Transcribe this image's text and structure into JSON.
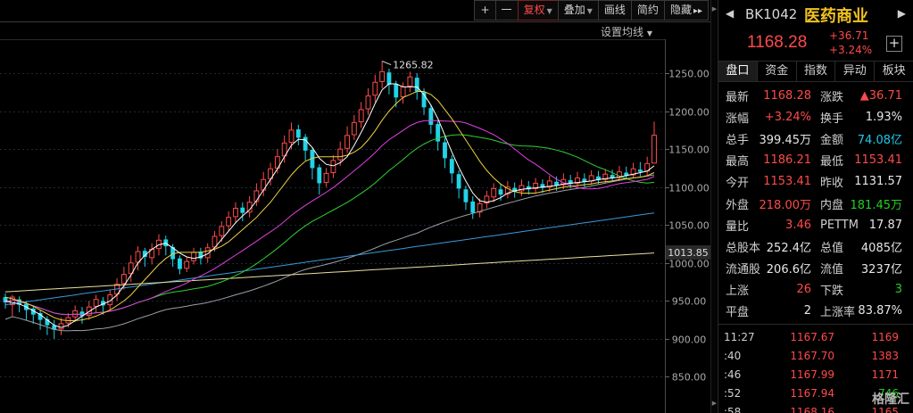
{
  "toolbar": {
    "plus": "+",
    "minus": "一",
    "fuquan": "复权",
    "diejia": "叠加",
    "huaxian": "画线",
    "jianyue": "简约",
    "yincang": "隐藏",
    "more": "▸▸"
  },
  "settings_ma_label": "设置均线",
  "colors": {
    "up": "#ff4a4a",
    "down": "#22d3e6",
    "ma5": "#ffffff",
    "ma10": "#f0d040",
    "ma20": "#e040e0",
    "ma30": "#30d030",
    "ma60": "#9aa0a6",
    "ma120": "#3a9ad9",
    "ma250": "#e8e0a0"
  },
  "chart_data": {
    "type": "candlestick",
    "y_ticks": [
      "1250.00",
      "1200.00",
      "1150.00",
      "1100.00",
      "1050.00",
      "1000.00",
      "950.00",
      "900.00",
      "850.00"
    ],
    "ylim": [
      820,
      1290
    ],
    "current_marker": "1013.85",
    "peak_label": "1265.82",
    "candles": [
      [
        955,
        948,
        940,
        960
      ],
      [
        945,
        955,
        930,
        958
      ],
      [
        952,
        945,
        935,
        956
      ],
      [
        946,
        938,
        925,
        950
      ],
      [
        940,
        932,
        920,
        944
      ],
      [
        934,
        925,
        912,
        938
      ],
      [
        926,
        918,
        905,
        930
      ],
      [
        918,
        912,
        900,
        925
      ],
      [
        913,
        920,
        905,
        928
      ],
      [
        921,
        928,
        915,
        934
      ],
      [
        929,
        937,
        922,
        944
      ],
      [
        936,
        930,
        920,
        942
      ],
      [
        931,
        942,
        925,
        950
      ],
      [
        943,
        952,
        935,
        958
      ],
      [
        950,
        944,
        932,
        955
      ],
      [
        945,
        958,
        938,
        965
      ],
      [
        959,
        972,
        950,
        980
      ],
      [
        973,
        985,
        965,
        995
      ],
      [
        986,
        1000,
        975,
        1010
      ],
      [
        1001,
        1015,
        990,
        1022
      ],
      [
        1016,
        1008,
        995,
        1020
      ],
      [
        1007,
        1018,
        998,
        1026
      ],
      [
        1019,
        1030,
        1010,
        1038
      ],
      [
        1031,
        1022,
        1010,
        1036
      ],
      [
        1021,
        1005,
        995,
        1025
      ],
      [
        1006,
        992,
        985,
        1010
      ],
      [
        993,
        1002,
        988,
        1008
      ],
      [
        1003,
        1014,
        998,
        1020
      ],
      [
        1015,
        1006,
        998,
        1020
      ],
      [
        1007,
        1020,
        1000,
        1026
      ],
      [
        1021,
        1035,
        1015,
        1042
      ],
      [
        1036,
        1048,
        1028,
        1055
      ],
      [
        1049,
        1060,
        1042,
        1068
      ],
      [
        1061,
        1072,
        1052,
        1080
      ],
      [
        1073,
        1066,
        1055,
        1080
      ],
      [
        1067,
        1080,
        1060,
        1088
      ],
      [
        1081,
        1095,
        1075,
        1105
      ],
      [
        1096,
        1110,
        1088,
        1120
      ],
      [
        1111,
        1124,
        1102,
        1132
      ],
      [
        1125,
        1140,
        1118,
        1150
      ],
      [
        1141,
        1158,
        1132,
        1168
      ],
      [
        1159,
        1175,
        1150,
        1185
      ],
      [
        1176,
        1165,
        1155,
        1182
      ],
      [
        1166,
        1148,
        1135,
        1170
      ],
      [
        1149,
        1125,
        1110,
        1152
      ],
      [
        1126,
        1105,
        1090,
        1130
      ],
      [
        1106,
        1118,
        1100,
        1125
      ],
      [
        1119,
        1135,
        1112,
        1142
      ],
      [
        1136,
        1150,
        1128,
        1160
      ],
      [
        1151,
        1168,
        1145,
        1180
      ],
      [
        1169,
        1185,
        1162,
        1195
      ],
      [
        1186,
        1202,
        1178,
        1212
      ],
      [
        1203,
        1220,
        1195,
        1230
      ],
      [
        1221,
        1238,
        1212,
        1248
      ],
      [
        1239,
        1252,
        1230,
        1265.82
      ],
      [
        1251,
        1235,
        1222,
        1256
      ],
      [
        1236,
        1218,
        1205,
        1240
      ],
      [
        1219,
        1232,
        1210,
        1238
      ],
      [
        1233,
        1245,
        1225,
        1252
      ],
      [
        1244,
        1226,
        1215,
        1250
      ],
      [
        1225,
        1205,
        1195,
        1230
      ],
      [
        1204,
        1182,
        1170,
        1208
      ],
      [
        1183,
        1160,
        1148,
        1188
      ],
      [
        1159,
        1138,
        1125,
        1165
      ],
      [
        1137,
        1118,
        1105,
        1142
      ],
      [
        1117,
        1098,
        1085,
        1122
      ],
      [
        1097,
        1080,
        1070,
        1102
      ],
      [
        1081,
        1066,
        1058,
        1088
      ],
      [
        1067,
        1078,
        1060,
        1085
      ],
      [
        1079,
        1088,
        1072,
        1095
      ],
      [
        1087,
        1098,
        1080,
        1105
      ],
      [
        1097,
        1090,
        1082,
        1104
      ],
      [
        1091,
        1100,
        1085,
        1108
      ],
      [
        1099,
        1094,
        1086,
        1106
      ],
      [
        1095,
        1102,
        1088,
        1110
      ],
      [
        1101,
        1097,
        1090,
        1108
      ],
      [
        1098,
        1105,
        1092,
        1112
      ],
      [
        1104,
        1099,
        1092,
        1110
      ],
      [
        1100,
        1108,
        1094,
        1115
      ],
      [
        1107,
        1102,
        1095,
        1114
      ],
      [
        1103,
        1110,
        1097,
        1118
      ],
      [
        1109,
        1104,
        1098,
        1116
      ],
      [
        1105,
        1112,
        1100,
        1120
      ],
      [
        1111,
        1107,
        1100,
        1118
      ],
      [
        1108,
        1115,
        1103,
        1122
      ],
      [
        1114,
        1109,
        1104,
        1121
      ],
      [
        1110,
        1117,
        1105,
        1124
      ],
      [
        1116,
        1112,
        1107,
        1123
      ],
      [
        1113,
        1120,
        1108,
        1128
      ],
      [
        1119,
        1115,
        1110,
        1127
      ],
      [
        1116,
        1124,
        1112,
        1132
      ],
      [
        1123,
        1120,
        1114,
        1133
      ],
      [
        1121,
        1131,
        1116,
        1140
      ],
      [
        1131.57,
        1168.28,
        1153.41,
        1186.21
      ]
    ],
    "ma_lines": {
      "ma5": [
        950,
        948,
        946,
        942,
        937,
        932,
        925,
        918,
        915,
        918,
        924,
        930,
        936,
        942,
        946,
        950,
        958,
        970,
        984,
        1000,
        1010,
        1018,
        1024,
        1026,
        1020,
        1013,
        1008,
        1006,
        1008,
        1012,
        1020,
        1031,
        1042,
        1053,
        1062,
        1070,
        1082,
        1096,
        1110,
        1124,
        1140,
        1155,
        1163,
        1162,
        1152,
        1138,
        1130,
        1128,
        1132,
        1140,
        1155,
        1172,
        1190,
        1210,
        1228,
        1236,
        1236,
        1232,
        1232,
        1232,
        1222,
        1208,
        1190,
        1168,
        1146,
        1126,
        1108,
        1092,
        1082,
        1080,
        1082,
        1086,
        1092,
        1095,
        1097,
        1098,
        1099,
        1100,
        1101,
        1102,
        1104,
        1105,
        1106,
        1107,
        1108,
        1110,
        1111,
        1112,
        1113,
        1115,
        1117,
        1119,
        1121,
        1128
      ],
      "ma10": [
        955,
        953,
        950,
        947,
        943,
        938,
        933,
        928,
        925,
        924,
        924,
        925,
        927,
        930,
        934,
        938,
        944,
        950,
        958,
        968,
        978,
        988,
        998,
        1006,
        1012,
        1014,
        1014,
        1014,
        1014,
        1016,
        1018,
        1022,
        1028,
        1036,
        1044,
        1052,
        1060,
        1070,
        1080,
        1092,
        1104,
        1116,
        1126,
        1134,
        1138,
        1140,
        1140,
        1140,
        1140,
        1142,
        1146,
        1152,
        1162,
        1174,
        1188,
        1200,
        1210,
        1218,
        1222,
        1226,
        1226,
        1222,
        1214,
        1202,
        1190,
        1176,
        1162,
        1148,
        1134,
        1122,
        1112,
        1104,
        1098,
        1094,
        1092,
        1092,
        1092,
        1094,
        1096,
        1098,
        1100,
        1101,
        1102,
        1103,
        1104,
        1106,
        1107,
        1108,
        1110,
        1111,
        1112,
        1113,
        1115,
        1119
      ]
    }
  },
  "stock": {
    "back": "◀",
    "code": "BK1042",
    "name": "医药商业",
    "fwd": "▶",
    "price": "1168.28",
    "chg": "+36.71",
    "pct": "+3.24%",
    "add": "+"
  },
  "tabs": [
    "盘口",
    "资金",
    "指数",
    "异动",
    "板块"
  ],
  "quote": [
    {
      "l1": "最新",
      "v1": "1168.28",
      "c1": "red",
      "l2": "涨跌",
      "v2": "▲36.71",
      "c2": "red"
    },
    {
      "l1": "涨幅",
      "v1": "+3.24%",
      "c1": "red",
      "l2": "换手",
      "v2": "1.93%",
      "c2": "white"
    },
    {
      "l1": "总手",
      "v1": "399.45万",
      "c1": "white",
      "l2": "金额",
      "v2": "74.08亿",
      "c2": "cyan"
    },
    {
      "l1": "最高",
      "v1": "1186.21",
      "c1": "red",
      "l2": "最低",
      "v2": "1153.41",
      "c2": "red"
    },
    {
      "l1": "今开",
      "v1": "1153.41",
      "c1": "red",
      "l2": "昨收",
      "v2": "1131.57",
      "c2": "white"
    },
    {
      "l1": "外盘",
      "v1": "218.00万",
      "c1": "red",
      "l2": "内盘",
      "v2": "181.45万",
      "c2": "green"
    },
    {
      "l1": "量比",
      "v1": "3.46",
      "c1": "red",
      "l2": "PETTM",
      "v2": "17.87",
      "c2": "white"
    },
    {
      "l1": "总股本",
      "v1": "252.4亿",
      "c1": "white",
      "l2": "总值",
      "v2": "4085亿",
      "c2": "white"
    },
    {
      "l1": "流通股",
      "v1": "206.6亿",
      "c1": "white",
      "l2": "流值",
      "v2": "3237亿",
      "c2": "white"
    },
    {
      "l1": "上涨",
      "v1": "26",
      "c1": "red",
      "l2": "下跌",
      "v2": "3",
      "c2": "green"
    },
    {
      "l1": "平盘",
      "v1": "2",
      "c1": "white",
      "l2": "上涨率",
      "v2": "83.87%",
      "c2": "white"
    }
  ],
  "ticks": [
    {
      "time": "11:27",
      "price": "1167.67",
      "vol": "1169",
      "vc": "red"
    },
    {
      "time": ":40",
      "price": "1167.70",
      "vol": "1383",
      "vc": "red"
    },
    {
      "time": ":46",
      "price": "1167.99",
      "vol": "1171",
      "vc": "red"
    },
    {
      "time": ":52",
      "price": "1167.94",
      "vol": "746",
      "vc": "green"
    },
    {
      "time": ":58",
      "price": "1168.16",
      "vol": "1165",
      "vc": "red"
    }
  ],
  "watermark": "格隆汇"
}
